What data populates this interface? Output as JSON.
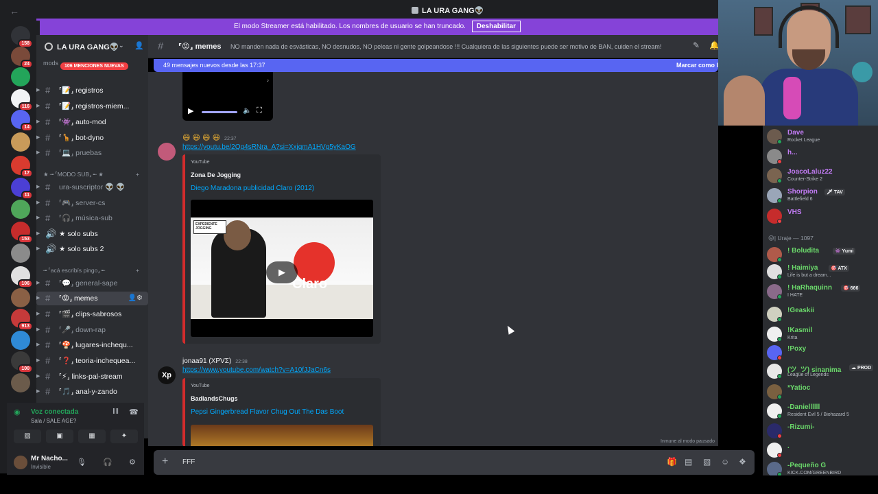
{
  "titlebar": {
    "title": "LA URA GANG👽"
  },
  "banner": {
    "text": "El modo Streamer está habilitado. Los nombres de usuario se han truncado.",
    "button": "Deshabilitar"
  },
  "guilds": [
    {
      "badge": "158",
      "color": "#313338"
    },
    {
      "badge": "24",
      "color": "#7a4a3a"
    },
    {
      "badge": "",
      "color": "#23a55a"
    },
    {
      "badge": "116",
      "color": "#f2f3f5"
    },
    {
      "badge": "14",
      "color": "#5865f2"
    },
    {
      "badge": "",
      "color": "#c99b5a"
    },
    {
      "badge": "17",
      "color": "#d93b2f"
    },
    {
      "badge": "11",
      "color": "#4b3fd4"
    },
    {
      "badge": "",
      "color": "#4fa65a"
    },
    {
      "badge": "153",
      "color": "#c62c2c"
    },
    {
      "badge": "",
      "color": "#8b8b8b"
    },
    {
      "badge": "106",
      "color": "#e0e0e0"
    },
    {
      "badge": "",
      "color": "#8a6045"
    },
    {
      "badge": "913",
      "color": "#c63a3a"
    },
    {
      "badge": "",
      "color": "#2f8ad6"
    },
    {
      "badge": "100",
      "color": "#3a3a3a"
    },
    {
      "badge": "",
      "color": "#6b5b4b"
    }
  ],
  "server": {
    "name": "LA URA GANG👽",
    "mentions_pill": "106 MENCIONES NUEVAS",
    "mods_label": "mods"
  },
  "channels": {
    "top": [
      {
        "name": "mods",
        "prefix": "🔊"
      },
      {
        "name": "⸢📝⸥ registros",
        "prefix": "#"
      },
      {
        "name": "⸢📝⸥ registros-miem...",
        "prefix": "#"
      },
      {
        "name": "⸢👾⸥ auto-mod",
        "prefix": "#"
      },
      {
        "name": "⸢🦒⸥ bot-dyno",
        "prefix": "#"
      },
      {
        "name": "⸢💻⸥ pruebas",
        "prefix": "#"
      }
    ],
    "cat_sub": "★ ╼ ⸢MODO SUB⸥ ╾ ★",
    "sub": [
      {
        "name": "ura-suscriptor 👽 👽",
        "prefix": "#"
      },
      {
        "name": "⸢🎮⸥ server-cs",
        "prefix": "#"
      },
      {
        "name": "⸢🎧⸥ música-sub",
        "prefix": "#"
      },
      {
        "name": "★ solo subs",
        "prefix": "🔊"
      },
      {
        "name": "★ solo subs 2",
        "prefix": "🔊"
      }
    ],
    "cat_main": "╼ ⸢acá escribís pingo⸥ ╾",
    "main": [
      {
        "name": "⸢💬⸥ general-sape",
        "prefix": "#"
      },
      {
        "name": "⸢😡⸥ memes",
        "prefix": "#"
      },
      {
        "name": "⸢🎬⸥ clips-sabrosos",
        "prefix": "#"
      },
      {
        "name": "⸢🎤⸥ down-rap",
        "prefix": "#"
      },
      {
        "name": "⸢🍄⸥ lugares-inchequ...",
        "prefix": "#"
      },
      {
        "name": "⸢❓⸥ teoria-inchequea...",
        "prefix": "#"
      },
      {
        "name": "⸢⚡⸥ links-pal-stream",
        "prefix": "#"
      },
      {
        "name": "⸢🎵⸥ anal-y-zando",
        "prefix": "#"
      }
    ]
  },
  "voice": {
    "status": "Voz conectada",
    "room": "Sala / SALE AGE?"
  },
  "user": {
    "name": "Mr Nacho...",
    "status": "Invisible"
  },
  "channel_header": {
    "name": "⸢😡⸥ memes",
    "topic": "NO manden nada de esvásticas, NO desnudos, NO peleas ni gente golpeandose !!! Cualquiera de las siguientes puede ser motivo de BAN, cuiden el stream!"
  },
  "new_messages": {
    "text": "49 mensajes nuevos desde las 17:37",
    "mark": "Marcar como l"
  },
  "messages": [
    {
      "emoji": "😄 😄 😄 😄",
      "time": "22:37",
      "link": "https://youtu.be/2Qg4sRNra_A?si=XxjqmA1HVg5yKaOG",
      "embed": {
        "provider": "YouTube",
        "channel": "Zona De Jogging",
        "title": "Diego Maradona publicidad Claro (2012)",
        "video_badge": "EXPEDIENTE JOGGING",
        "brand": "Claro"
      }
    },
    {
      "author": "jonaa91 (ΧΡVΣ)",
      "time": "22:38",
      "link": "https://www.youtube.com/watch?v=A10fJJaCn6s",
      "embed": {
        "provider": "YouTube",
        "channel": "BadlandsChugs",
        "title": "Pepsi Gingerbread Flavor Chug Out The Das Boot"
      }
    }
  ],
  "immune": "Inmune al modo pausado",
  "composer": {
    "text": "FFF"
  },
  "members_top": [
    {
      "name": "Dave",
      "activity": "Rocket League",
      "color": "#c27cf5",
      "av": "#6c5b4e",
      "dot": "#23a55a",
      "tag": ""
    },
    {
      "name": "h...",
      "activity": "",
      "color": "#c27cf5",
      "av": "#8a8a8a",
      "dot": "#f23f43",
      "tag": ""
    },
    {
      "name": "JoacoLaluz22",
      "activity": "Counter-Strike 2",
      "color": "#c27cf5",
      "av": "#7a6450",
      "dot": "#23a55a",
      "tag": ""
    },
    {
      "name": "Shorpion",
      "activity": "Battlefield 6",
      "color": "#c27cf5",
      "av": "#9aa6b8",
      "dot": "#23a55a",
      "tag": "🗡 TAV"
    },
    {
      "name": "VHS",
      "activity": "",
      "color": "#c27cf5",
      "av": "#c62c2c",
      "dot": "#f23f43",
      "tag": ""
    }
  ],
  "group_label": "😜| Uraje — 1097",
  "members_group": [
    {
      "name": "! Boludita",
      "activity": "",
      "color": "#6bd96b",
      "av": "#b05a4a",
      "dot": "#23a55a",
      "tag": "👾 Yumi"
    },
    {
      "name": "! Haimiya",
      "activity": "Life is but a dream...",
      "color": "#6bd96b",
      "av": "#e0e0e0",
      "dot": "#23a55a",
      "tag": "🎯 ATX"
    },
    {
      "name": "! HaRhaquinn",
      "activity": "I HATE",
      "color": "#6bd96b",
      "av": "#8a6a8a",
      "dot": "#23a55a",
      "tag": "🎯 666"
    },
    {
      "name": "!Geaskii",
      "activity": "",
      "color": "#6bd96b",
      "av": "#d0d0c0",
      "dot": "#23a55a",
      "tag": ""
    },
    {
      "name": "!Kasmil",
      "activity": "Krita",
      "color": "#6bd96b",
      "av": "#f0f0f0",
      "dot": "#23a55a",
      "tag": ""
    },
    {
      "name": "!Poxy",
      "activity": "",
      "color": "#6bd96b",
      "av": "#5865f2",
      "dot": "#f23f43",
      "tag": ""
    },
    {
      "name": "(ツ_ツ) sinanima",
      "activity": "League of Legends",
      "color": "#6bd96b",
      "av": "#e8e8e8",
      "dot": "#23a55a",
      "tag": "☁ PROD"
    },
    {
      "name": "*Yatioc",
      "activity": "",
      "color": "#6bd96b",
      "av": "#7a6040",
      "dot": "#23a55a",
      "tag": ""
    },
    {
      "name": "-Daniellllll",
      "activity": "Resident Evil 5 / Biohazard 5",
      "color": "#6bd96b",
      "av": "#f0f0f0",
      "dot": "#23a55a",
      "tag": ""
    },
    {
      "name": "-Rizumi-",
      "activity": "",
      "color": "#6bd96b",
      "av": "#2a2a6a",
      "dot": "#f23f43",
      "tag": ""
    },
    {
      "name": ".",
      "activity": "",
      "color": "#6bd96b",
      "av": "#f0f0f0",
      "dot": "#f23f43",
      "tag": ""
    },
    {
      "name": "-Pequeño G",
      "activity": "KICK.COM/GREENBIRD",
      "color": "#6bd96b",
      "av": "#5a6a8a",
      "dot": "#23a55a",
      "tag": ""
    }
  ]
}
